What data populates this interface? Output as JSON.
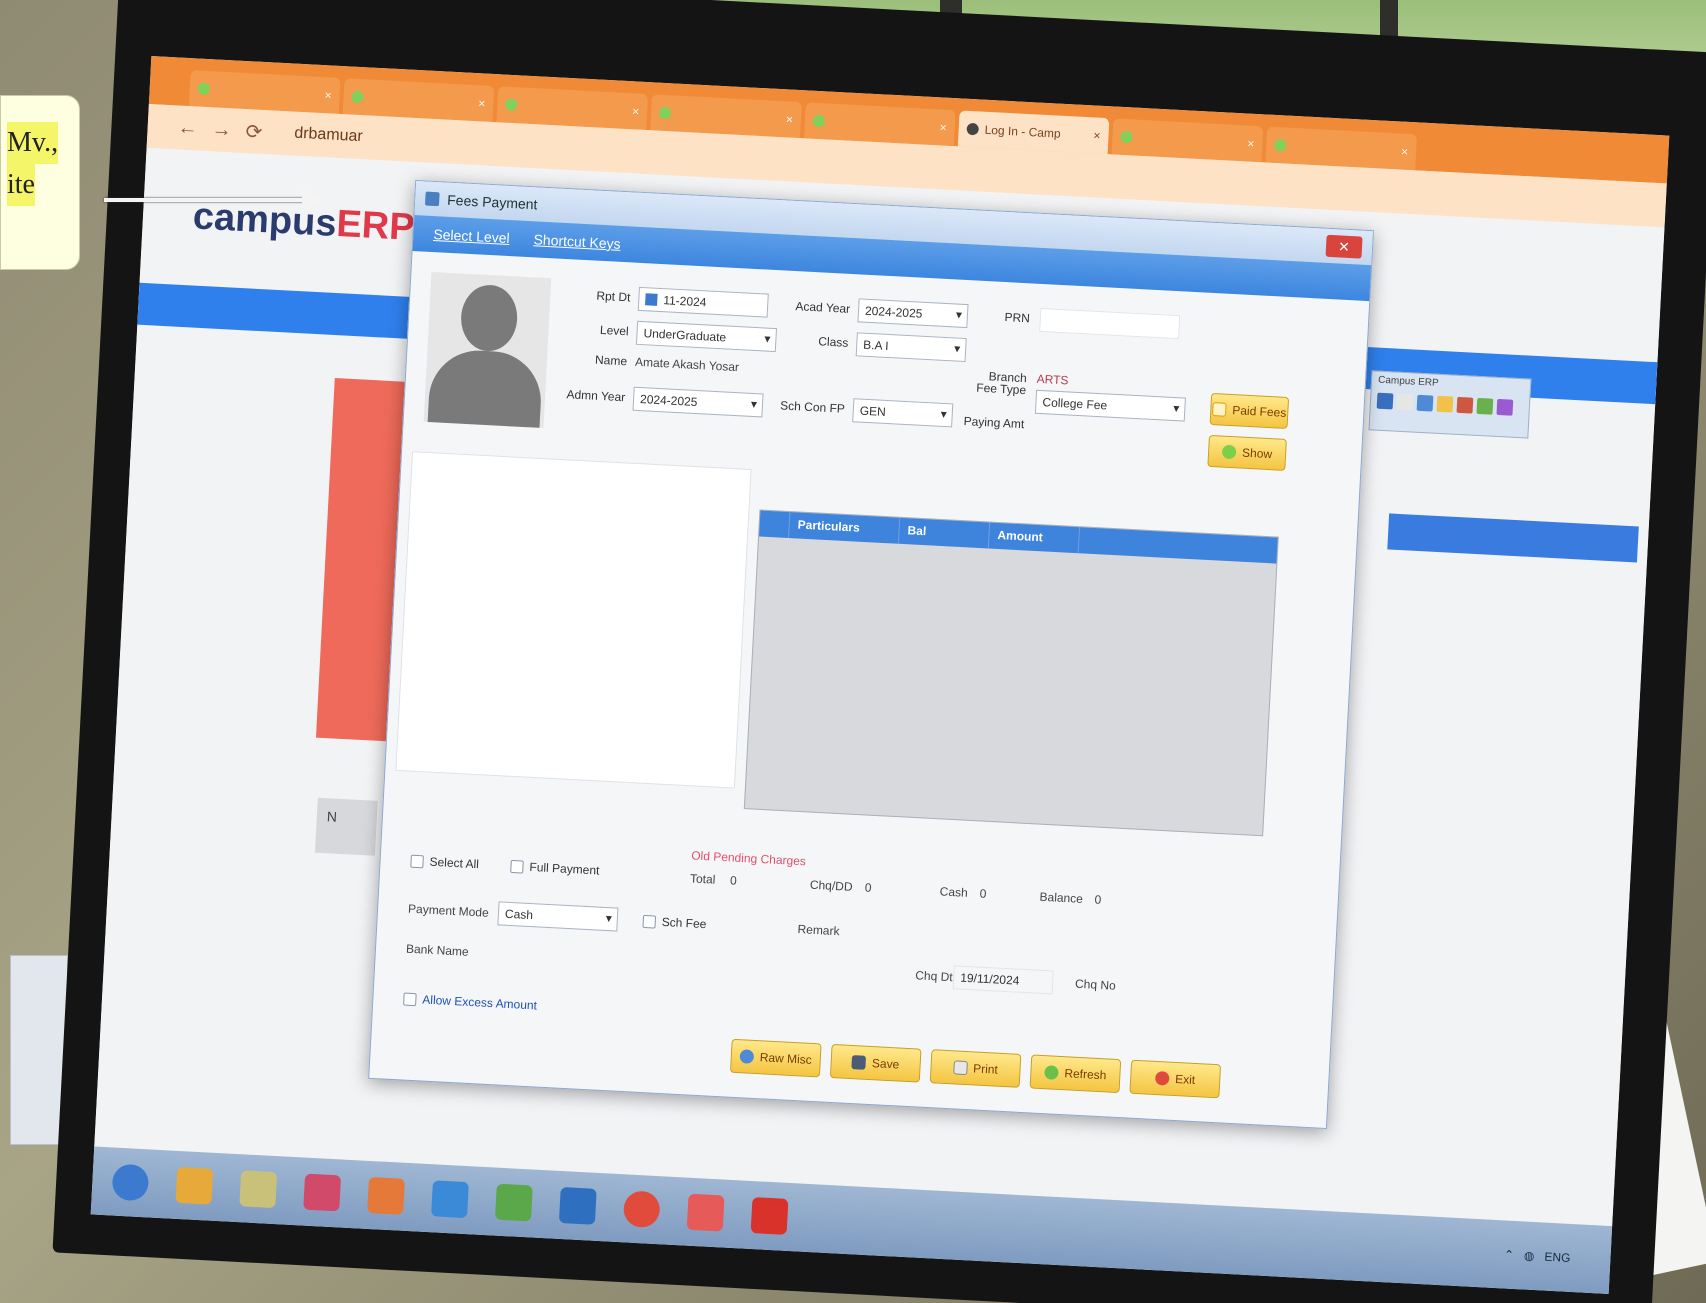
{
  "photo_caption": {
    "lines": [
      "",
      "Mv.,",
      "ite"
    ]
  },
  "browser": {
    "tabs": [
      {
        "label": "",
        "active": false
      },
      {
        "label": "",
        "active": false
      },
      {
        "label": "",
        "active": false
      },
      {
        "label": "",
        "active": false
      },
      {
        "label": "",
        "active": false
      },
      {
        "label": "Log In - Camp",
        "active": true
      },
      {
        "label": "",
        "active": false
      },
      {
        "label": "",
        "active": false
      }
    ],
    "url": "drbamuar"
  },
  "webpage": {
    "logo_campus": "campus",
    "logo_erp": "ERP",
    "login_text": "N"
  },
  "dialog": {
    "title": "Fees Payment",
    "menu": [
      "Select Level",
      "Shortcut Keys"
    ],
    "fields": {
      "rpt_dt_label": "Rpt Dt",
      "rpt_dt_value": "11-2024",
      "acad_year_label": "Acad Year",
      "acad_year_value": "2024-2025",
      "prn_label": "PRN",
      "prn_value": "",
      "level_label": "Level",
      "level_value": "UnderGraduate",
      "class_label": "Class",
      "class_value": "B.A I",
      "name_label": "Name",
      "name_value": "Amate Akash Yosar",
      "branch_label": "Branch",
      "branch_value": "ARTS",
      "admn_year_label": "Admn Year",
      "admn_year_value": "2024-2025",
      "sch_con_label": "Sch Con FP",
      "sch_con_value": "GEN",
      "fee_type_label": "Fee Type",
      "fee_type_value": "College Fee",
      "paying_amt_label": "Paying Amt"
    },
    "side_buttons": [
      "Paid Fees",
      "Show"
    ],
    "grid_columns": [
      "Particulars",
      "Bal",
      "Amount"
    ],
    "red_note": "Old Pending Charges",
    "select_all": "Select All",
    "full_payment": "Full Payment",
    "summary": {
      "total_label": "Total",
      "total_value": "0",
      "chq_dd_label": "Chq/DD",
      "chq_dd_value": "0",
      "cash_label": "Cash",
      "cash_value": "0",
      "balance_label": "Balance",
      "balance_value": "0"
    },
    "payment_mode_label": "Payment Mode",
    "payment_mode_value": "Cash",
    "sch_fee_label": "Sch Fee",
    "remark_label": "Remark",
    "bank_name_label": "Bank Name",
    "chq_dt_label": "Chq Dt",
    "chq_dt_value": "19/11/2024",
    "chq_no_label": "Chq No",
    "allow_excess": "Allow Excess Amount",
    "bottom_buttons": [
      "Raw Misc",
      "Save",
      "Print",
      "Refresh",
      "Exit"
    ]
  },
  "mini_window": {
    "title": "Campus ERP"
  },
  "taskbar": {
    "tray_text": "ENG"
  },
  "colors": {
    "tab_orange": "#f08a36",
    "menu_blue": "#3d86df",
    "button_yellow": "#f4c542",
    "grid_header": "#3e83dc"
  }
}
